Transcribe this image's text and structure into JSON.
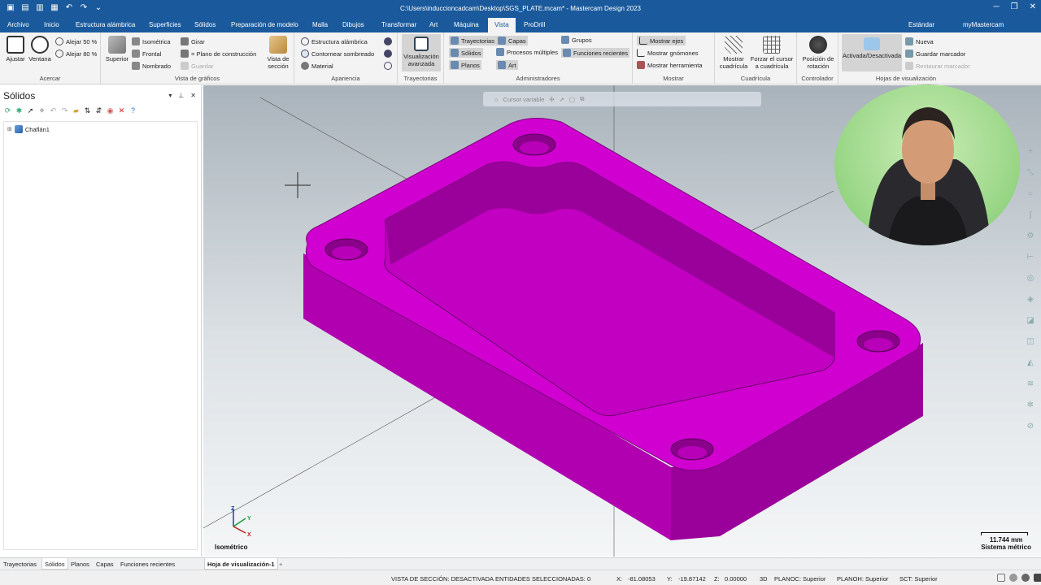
{
  "titlebar": {
    "title": "C:\\Users\\induccioncadcam\\Desktop\\SGS_PLATE.mcam* - Mastercam Design 2023",
    "minimize": "─",
    "restore": "❐",
    "close": "✕"
  },
  "menu": {
    "tabs": [
      "Archivo",
      "Inicio",
      "Estructura alámbrica",
      "Superficies",
      "Sólidos",
      "Preparación de modelo",
      "Malla",
      "Dibujos",
      "Transformar",
      "Art",
      "Máquina",
      "Vista",
      "ProDrill"
    ],
    "active": "Vista",
    "layout": "Estándar",
    "account": "myMastercam"
  },
  "ribbon": {
    "acercar": {
      "label": "Acercar",
      "ajustar": "Ajustar",
      "ventana": "Ventana",
      "alejar50": "Alejar 50 %",
      "alejar80": "Alejar 80 %"
    },
    "vista": {
      "label": "Vista de gráficos",
      "superior": "Superior",
      "isometrica": "Isométrica",
      "frontal": "Frontal",
      "nombrado": "Nombrado",
      "girar": "Girar",
      "plano": "= Plano de construcción",
      "guardar": "Guardar",
      "vista_seccion": "Vista de sección"
    },
    "apariencia": {
      "label": "Apariencia",
      "estructura": "Estructura alámbrica",
      "contornear": "Contornear sombreado",
      "material": "Material"
    },
    "trayectorias": {
      "label": "Trayectorias",
      "visualizacion": "Visualización avanzada"
    },
    "administradores": {
      "label": "Administradores",
      "trayectorias": "Trayectorias",
      "solidos": "Sólidos",
      "planos": "Planos",
      "capas": "Capas",
      "procesos": "Procesos múltiples",
      "art": "Art",
      "grupos": "Grupos",
      "funciones": "Funciones recientes"
    },
    "mostrar": {
      "label": "Mostrar",
      "ejes": "Mostrar ejes",
      "gnomones": "Mostrar gnómones",
      "herramienta": "Mostrar herramienta"
    },
    "cuadricula": {
      "label": "Cuadrícula",
      "mostrar": "Mostrar cuadrícula",
      "forzar": "Forzar el cursor a cuadrícula"
    },
    "controlador": {
      "label": "Controlador",
      "posicion": "Posición de rotación"
    },
    "hojas": {
      "label": "Hojas de visualización",
      "activada": "Activada/Desactivada",
      "nueva": "Nueva",
      "guardar": "Guardar marcador",
      "restaurar": "Restaurar marcador"
    }
  },
  "panel": {
    "title": "Sólidos",
    "tree_item": "Chaflán1"
  },
  "viewport": {
    "toolbar_label": "Cursor variable",
    "view_name": "Isométrico",
    "scale_value": "11.744 mm",
    "scale_system": "Sistema métrico",
    "solid_color": "#c400c4",
    "axes": {
      "z": "Z",
      "y": "Y",
      "x": "X"
    }
  },
  "bottom_tabs": {
    "manager_tabs": [
      "Trayectorias",
      "Sólidos",
      "Planos",
      "Capas",
      "Funciones recientes"
    ],
    "active_manager": "Sólidos",
    "sheet": "Hoja de visualización-1",
    "add": "+"
  },
  "status": {
    "seccion": "VISTA DE SECCIÓN: DESACTIVADA",
    "entidades": "ENTIDADES SELECCIONADAS: 0",
    "x_label": "X:",
    "x": "-81.08053",
    "y_label": "Y:",
    "y": "-19.87142",
    "z_label": "Z:",
    "z": "0.00000",
    "mode": "3D",
    "planoc": "PLANOC: Superior",
    "planoh": "PLANOH: Superior",
    "sct": "SCT: Superior"
  }
}
